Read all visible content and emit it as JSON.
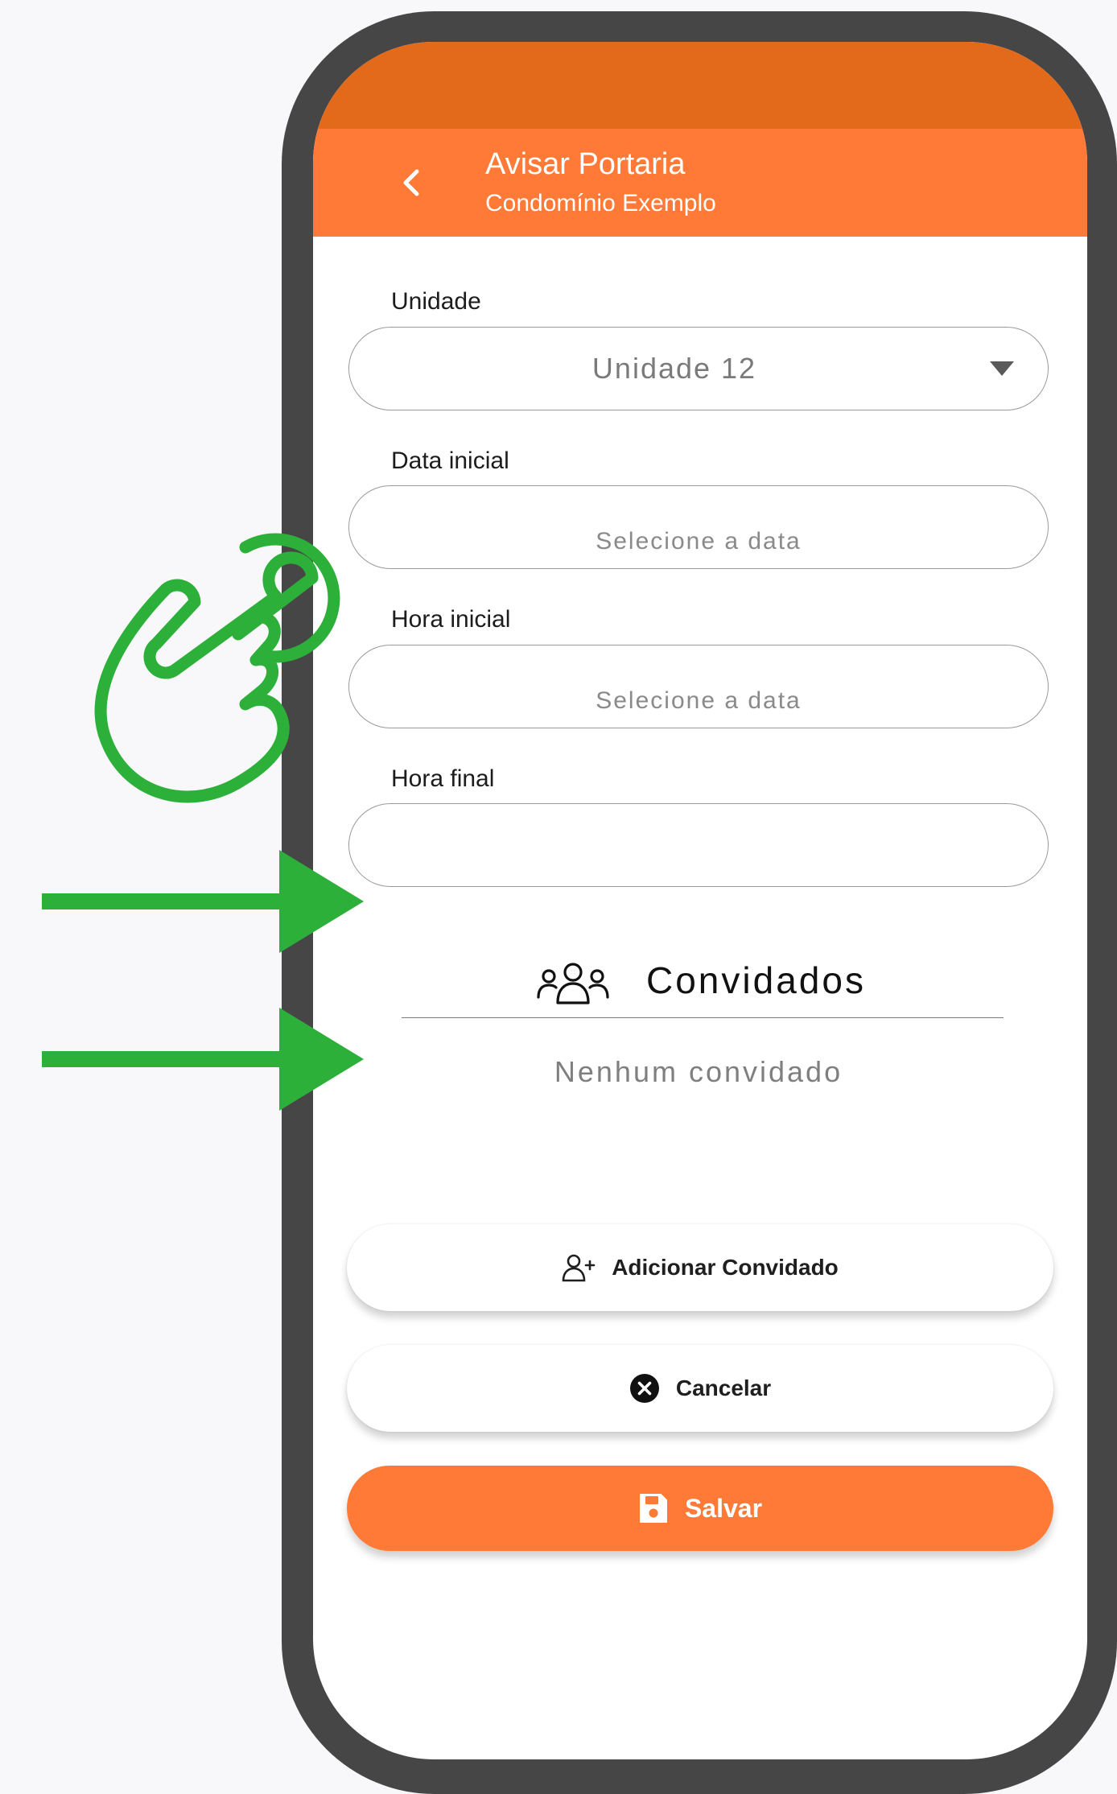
{
  "header": {
    "title": "Avisar Portaria",
    "subtitle": "Condomínio Exemplo",
    "back_icon": "chevron-left-icon"
  },
  "form": {
    "unit": {
      "label": "Unidade",
      "value": "Unidade 12"
    },
    "start_date": {
      "label": "Data inicial",
      "placeholder": "Selecione a data"
    },
    "start_time": {
      "label": "Hora inicial",
      "placeholder": "Selecione a data"
    },
    "end_time": {
      "label": "Hora final",
      "placeholder": ""
    }
  },
  "guests": {
    "title": "Convidados",
    "icon": "group-icon",
    "empty_text": "Nenhum convidado"
  },
  "actions": {
    "add_guest_label": "Adicionar Convidado",
    "cancel_label": "Cancelar",
    "save_label": "Salvar"
  },
  "colors": {
    "status_bar": "#e36a1a",
    "app_bar": "#ff7a36",
    "annotation_green": "#2db039",
    "phone_frame": "#464646"
  },
  "annotations": {
    "icons": [
      "tap-hand-icon",
      "arrow-right-icon",
      "arrow-right-icon"
    ]
  }
}
